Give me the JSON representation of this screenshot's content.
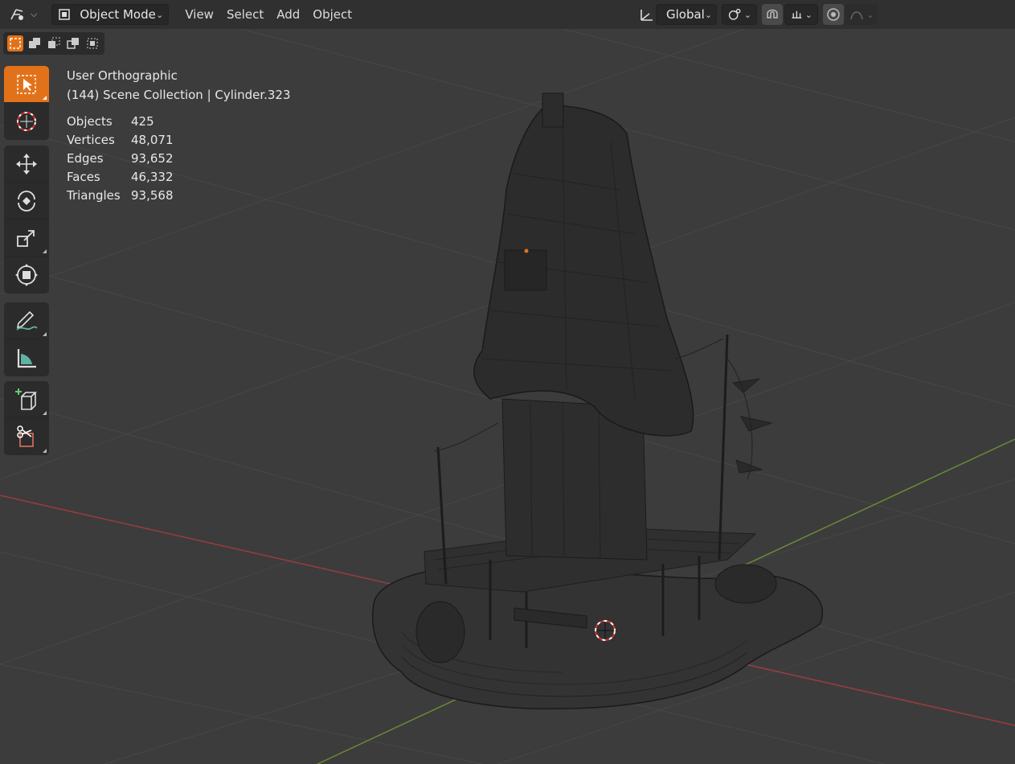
{
  "header": {
    "mode": "Object Mode",
    "menus": [
      "View",
      "Select",
      "Add",
      "Object"
    ],
    "orientation": "Global"
  },
  "overlay": {
    "view_name": "User Orthographic",
    "collection_info": "(144) Scene Collection | Cylinder.323",
    "stats": [
      {
        "label": "Objects",
        "value": "425"
      },
      {
        "label": "Vertices",
        "value": "48,071"
      },
      {
        "label": "Edges",
        "value": "93,652"
      },
      {
        "label": "Faces",
        "value": "46,332"
      },
      {
        "label": "Triangles",
        "value": "93,568"
      }
    ]
  },
  "tools": [
    "select-box-tool",
    "cursor-tool",
    "move-tool",
    "rotate-tool",
    "scale-tool",
    "transform-tool",
    "annotate-tool",
    "measure-tool",
    "add-cube-tool",
    "knife-tool"
  ],
  "colors": {
    "accent": "#e2721a",
    "viewport_bg": "#3c3c3c",
    "header_bg": "#303030",
    "x_axis": "#9b3c3c",
    "y_axis": "#6a8a36"
  }
}
